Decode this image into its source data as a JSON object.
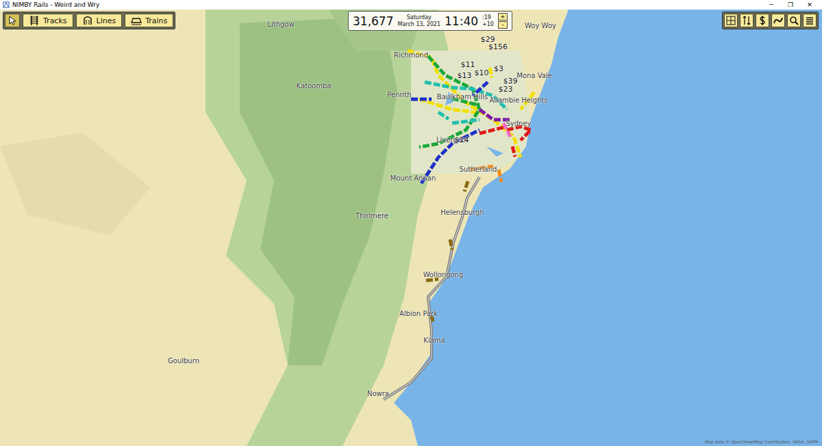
{
  "window": {
    "title": "NIMBY Rails - Weird and Wry",
    "controls": [
      "─",
      "❐",
      "✕"
    ]
  },
  "toolbar": {
    "pointer": {
      "selected": true
    },
    "modes": [
      {
        "label": "Tracks",
        "selected": false
      },
      {
        "label": "Lines",
        "selected": false
      },
      {
        "label": "Trains",
        "selected": false
      }
    ]
  },
  "clock": {
    "money": "31,677",
    "day": "Saturday",
    "date": "March 13, 2021",
    "time": "11:40",
    "seconds": ":19",
    "timezone": "+10",
    "faster": "+",
    "slower": "-"
  },
  "map": {
    "places": [
      "Lithgow",
      "Woy Woy",
      "Richmond",
      "Katoomba",
      "Penrith",
      "Mona Vale",
      "Baulkham Hills",
      "Allambie Heights",
      "Sydney",
      "Liverpool",
      "Mount Annan",
      "Sutherland",
      "Thirlmere",
      "Helensburgh",
      "Wollongong",
      "Albion Park",
      "Kiama",
      "Goulburn",
      "Nowra"
    ],
    "earnings": [
      "$29",
      "$156",
      "$11",
      "$13",
      "$10",
      "$3",
      "$39",
      "$23",
      "$14"
    ],
    "attribution": "Map data © OpenStreetMap Contributors, NASA, SRTM"
  },
  "lines": [
    {
      "color": "#f2e000"
    },
    {
      "color": "#1aa83a"
    },
    {
      "color": "#20bfae"
    },
    {
      "color": "#1f2fc8"
    },
    {
      "color": "#e01a1a"
    },
    {
      "color": "#7a1aa8"
    },
    {
      "color": "#f06ac8"
    },
    {
      "color": "#f08a1a"
    },
    {
      "color": "#8a6a10"
    }
  ]
}
